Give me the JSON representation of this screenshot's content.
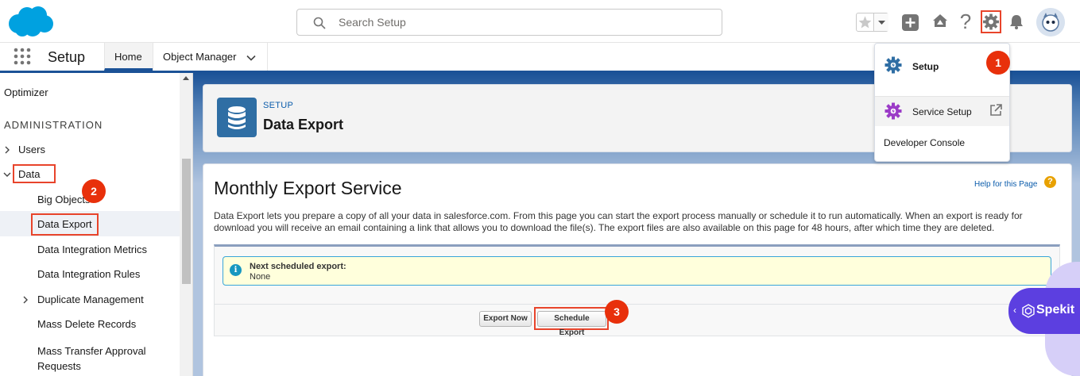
{
  "header": {
    "search_placeholder": "Search Setup",
    "help_symbol": "?"
  },
  "nav": {
    "app_name": "Setup",
    "tabs": [
      {
        "label": "Home"
      },
      {
        "label": "Object Manager"
      }
    ]
  },
  "sidebar": {
    "top_item": "Optimizer",
    "section": "ADMINISTRATION",
    "items": [
      {
        "label": "Users"
      },
      {
        "label": "Data"
      },
      {
        "label": "Big Objects"
      },
      {
        "label": "Data Export"
      },
      {
        "label": "Data Integration Metrics"
      },
      {
        "label": "Data Integration Rules"
      },
      {
        "label": "Duplicate Management"
      },
      {
        "label": "Mass Delete Records"
      },
      {
        "label": "Mass Transfer Approval Requests"
      }
    ]
  },
  "page_header": {
    "eyebrow": "SETUP",
    "title": "Data Export"
  },
  "card": {
    "title": "Monthly Export Service",
    "help_link": "Help for this Page",
    "help_symbol": "?",
    "description": "Data Export lets you prepare a copy of all your data in salesforce.com. From this page you can start the export process manually or schedule it to run automatically. When an export is ready for download you will receive an email containing a link that allows you to download the file(s). The export files are also available on this page for 48 hours, after which time they are deleted.",
    "info_icon": "i",
    "next_export_label": "Next scheduled export:",
    "next_export_value": "None",
    "export_now_button": "Export Now",
    "schedule_export_button": "Schedule Export"
  },
  "setup_menu": {
    "items": [
      {
        "label": "Setup",
        "icon": "setup-gear-icon"
      },
      {
        "label": "Service Setup",
        "icon": "service-setup-gear-icon"
      },
      {
        "label": "Developer Console"
      }
    ]
  },
  "badges": [
    "1",
    "2",
    "3"
  ],
  "spekit": {
    "label": "Spekit",
    "arrow": "‹"
  },
  "colors": {
    "brand_blue": "#1b5297",
    "highlight_red": "#e8442b",
    "badge_red": "#e8300b",
    "spekit_purple": "#5c3fe0",
    "service_setup_purple": "#9b3bc7",
    "setup_gear_blue": "#2f6ea4"
  }
}
